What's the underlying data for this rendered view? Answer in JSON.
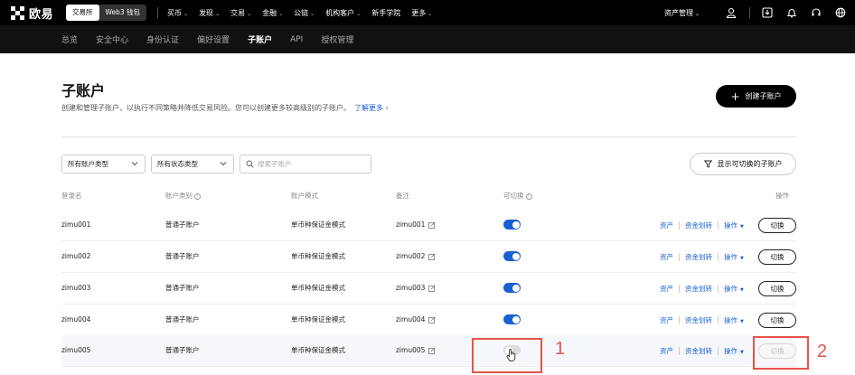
{
  "topnav": {
    "logo_text": "欧易",
    "modes": [
      "交易所",
      "Web3 钱包"
    ],
    "menu": [
      "买币",
      "发现",
      "交易",
      "金融",
      "公链",
      "机构客户",
      "新手学院",
      "更多"
    ],
    "asset_mgmt": "资产管理",
    "icons": [
      "user-icon",
      "download-icon",
      "bell-icon",
      "headset-icon",
      "globe-icon"
    ]
  },
  "subnav": {
    "items": [
      "总览",
      "安全中心",
      "身份认证",
      "偏好设置",
      "子账户",
      "API",
      "授权管理"
    ],
    "active": "子账户"
  },
  "page": {
    "title": "子账户",
    "description": "创建和管理子账户，以执行不同策略并降低交易风险。您可以创建更多较高级别的子账户。",
    "learn_more": "了解更多",
    "create_button": "创建子账户"
  },
  "filters": {
    "account_type": "所有账户类型",
    "status": "所有状态类型",
    "search_placeholder": "搜索子账户",
    "show_switchable": "显示可切换的子账户"
  },
  "table": {
    "headers": [
      "登录名",
      "账户类别",
      "账户模式",
      "备注",
      "可切换",
      "操作"
    ],
    "action_labels": {
      "assets": "资产",
      "transfer": "资金划转",
      "operate": "操作",
      "switch": "切换"
    },
    "rows": [
      {
        "login": "zimu001",
        "category": "普通子账户",
        "mode": "单币种保证金模式",
        "note": "zimu001",
        "switchable": true
      },
      {
        "login": "zimu002",
        "category": "普通子账户",
        "mode": "单币种保证金模式",
        "note": "zimu002",
        "switchable": true
      },
      {
        "login": "zimu003",
        "category": "普通子账户",
        "mode": "单币种保证金模式",
        "note": "zimu003",
        "switchable": true
      },
      {
        "login": "zimu004",
        "category": "普通子账户",
        "mode": "单币种保证金模式",
        "note": "zimu004",
        "switchable": true
      },
      {
        "login": "zimu005",
        "category": "普通子账户",
        "mode": "单币种保证金模式",
        "note": "zimu005",
        "switchable": false
      }
    ]
  },
  "annotations": [
    "1",
    "2"
  ],
  "colors": {
    "accent": "#1b5fd1",
    "annotation": "#e7534a",
    "topbar": "#000000"
  }
}
